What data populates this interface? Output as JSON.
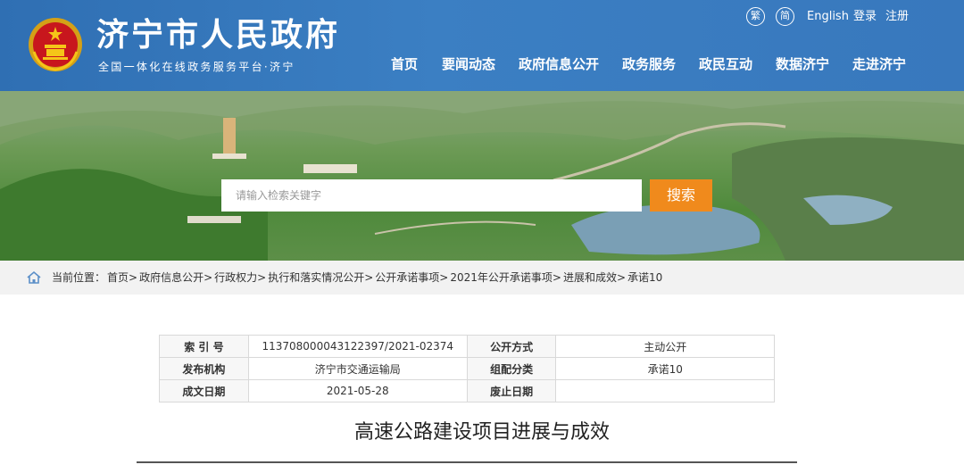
{
  "header": {
    "title": "济宁市人民政府",
    "subtitle": "全国一体化在线政务服务平台·济宁",
    "util": {
      "traditional": "繁",
      "simplified": "简",
      "english": "English",
      "login": "登录",
      "register": "注册"
    },
    "nav": [
      "首页",
      "要闻动态",
      "政府信息公开",
      "政务服务",
      "政民互动",
      "数据济宁",
      "走进济宁"
    ]
  },
  "search": {
    "placeholder": "请输入检索关键字",
    "button": "搜索"
  },
  "breadcrumb": {
    "prefix": "当前位置：",
    "items": [
      "首页>",
      "政府信息公开>",
      "行政权力>",
      "执行和落实情况公开>",
      "公开承诺事项>",
      "2021年公开承诺事项>",
      "进展和成效>",
      "承诺10"
    ]
  },
  "info": {
    "rows": [
      {
        "k1": "索 引 号",
        "v1": "113708000043122397/2021-02374",
        "k2": "公开方式",
        "v2": "主动公开"
      },
      {
        "k1": "发布机构",
        "v1": "济宁市交通运输局",
        "k2": "组配分类",
        "v2": "承诺10"
      },
      {
        "k1": "成文日期",
        "v1": "2021-05-28",
        "k2": "废止日期",
        "v2": ""
      }
    ]
  },
  "document": {
    "title": "高速公路建设项目进展与成效"
  },
  "colors": {
    "header_blue": "#3b7fc3",
    "search_orange": "#f08a1c",
    "crumb_bg": "#f2f2f2"
  }
}
